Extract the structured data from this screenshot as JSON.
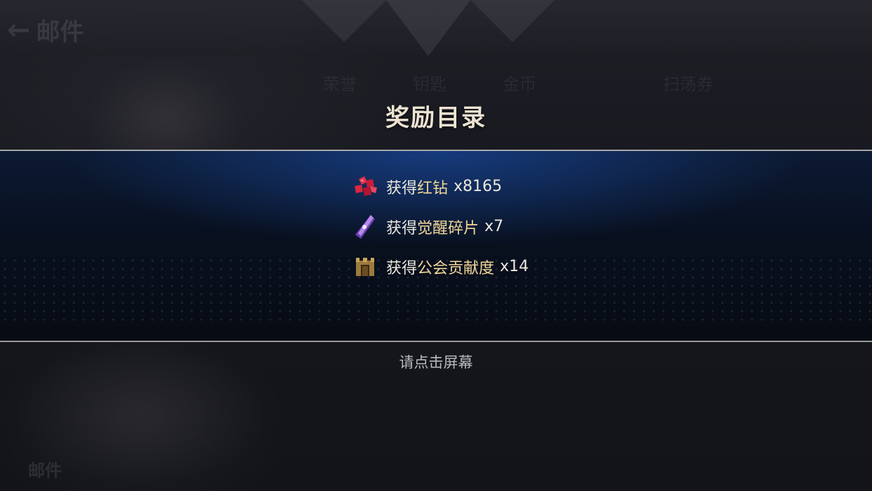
{
  "background": {
    "back_label": "邮件",
    "bottom_label": "邮件",
    "tabs": [
      "荣誉",
      "钥匙",
      "金币",
      "扫荡券"
    ]
  },
  "dialog": {
    "title": "奖励目录",
    "rewards": [
      {
        "prefix": "获得",
        "name": "红钻",
        "qty": "x8165",
        "icon": "red-diamond-icon"
      },
      {
        "prefix": "获得",
        "name": "觉醒碎片",
        "qty": "x7",
        "icon": "awakening-shard-icon"
      },
      {
        "prefix": "获得",
        "name": "公会贡献度",
        "qty": "x14",
        "icon": "guild-gate-icon"
      }
    ],
    "hint": "请点击屏幕"
  },
  "colors": {
    "title": "#ece3d2",
    "item_name": "#f2d79a",
    "panel_glow": "#1946a0"
  }
}
